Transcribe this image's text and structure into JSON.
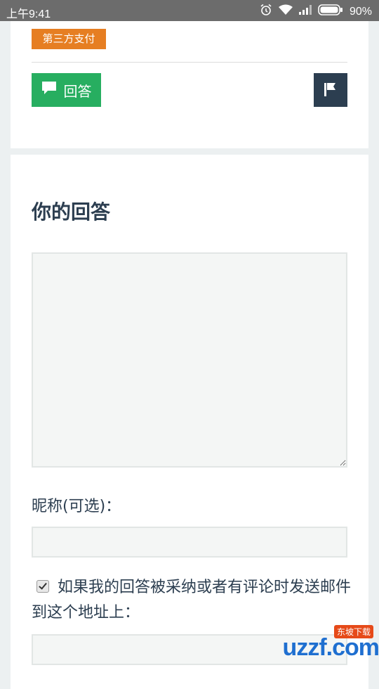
{
  "status_bar": {
    "time": "上午9:41",
    "battery": "90%",
    "icons": [
      "alarm-icon",
      "wifi-icon",
      "signal-icon",
      "battery-icon"
    ]
  },
  "question_card": {
    "tag": "第三方支付",
    "answer_button_label": "回答",
    "answer_icon": "chat-bubble-icon",
    "flag_icon": "flag-icon"
  },
  "answer_form": {
    "title": "你的回答",
    "answer_textarea_value": "",
    "nickname_label": "昵称(可选)：",
    "nickname_value": "",
    "notify_checked": true,
    "notify_label": "如果我的回答被采纳或者有评论时发送邮件到这个地址上：",
    "email_value": ""
  },
  "watermark": {
    "logo_text": "uzzf.com",
    "badge_text": "东坡下载"
  },
  "colors": {
    "tag": "#e67e22",
    "answer_button": "#27ae60",
    "flag_button": "#2c3e50",
    "page_background": "#ecf0f1"
  }
}
